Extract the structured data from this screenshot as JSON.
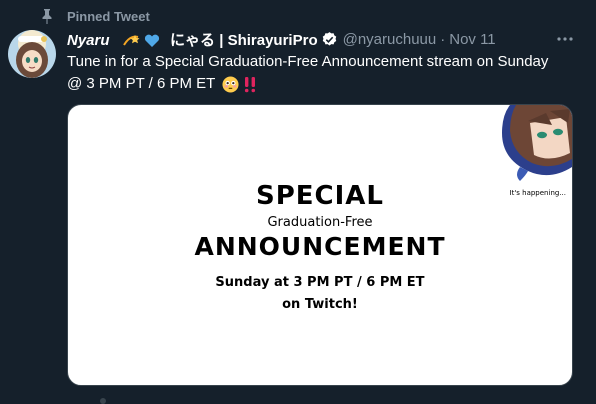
{
  "pinned": {
    "label": "Pinned Tweet",
    "icon": "pin-icon"
  },
  "author": {
    "display_name": "Nyaru",
    "display_name_rest": "にゃる | ShirayuriPro",
    "emojis": [
      "dizzy-emoji",
      "blue-heart-emoji"
    ],
    "handle": "@nyaruchuuu",
    "separator": "·",
    "date": "Nov 11",
    "verified": true
  },
  "tweet": {
    "text": "Tune in for a Special Graduation-Free Announcement stream on Sunday @ 3 PM PT / 6 PM ET",
    "trailing_emojis": [
      "flushed-face-emoji",
      "double-exclamation-emoji"
    ]
  },
  "media": {
    "title": "SPECIAL",
    "subtitle": "Graduation-Free",
    "headline": "ANNOUNCEMENT",
    "when": "Sunday at 3 PM PT / 6 PM ET",
    "where": "on Twitch!",
    "caption": "It's happening..."
  },
  "colors": {
    "background": "#15202b",
    "muted_text": "#8b98a5",
    "verified": "#ffffff",
    "heart": "#4fa8e8",
    "exclaim": "#e0245e"
  }
}
